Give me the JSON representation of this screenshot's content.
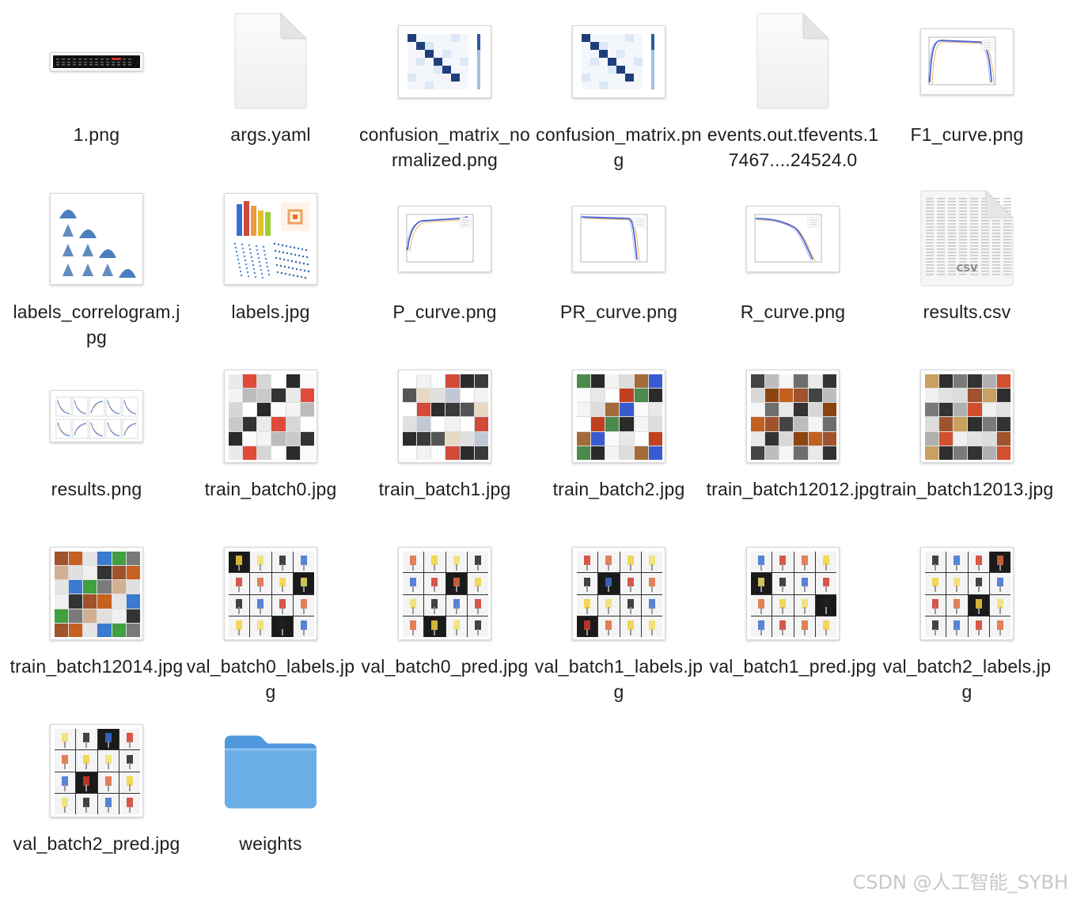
{
  "files": [
    {
      "name": "1.png",
      "icon": "image-thumbnail"
    },
    {
      "name": "args.yaml",
      "icon": "blank-document-icon"
    },
    {
      "name": "confusion_matrix_normalized.png",
      "icon": "confusion-matrix-thumbnail"
    },
    {
      "name": "confusion_matrix.png",
      "icon": "confusion-matrix-thumbnail"
    },
    {
      "name": "events.out.tfevents.17467....24524.0",
      "icon": "blank-document-icon"
    },
    {
      "name": "F1_curve.png",
      "icon": "curve-chart-thumbnail"
    },
    {
      "name": "labels_correlogram.jpg",
      "icon": "correlogram-thumbnail"
    },
    {
      "name": "labels.jpg",
      "icon": "labels-chart-thumbnail"
    },
    {
      "name": "P_curve.png",
      "icon": "curve-chart-thumbnail"
    },
    {
      "name": "PR_curve.png",
      "icon": "curve-chart-thumbnail"
    },
    {
      "name": "R_curve.png",
      "icon": "curve-chart-thumbnail"
    },
    {
      "name": "results.csv",
      "icon": "csv-document-icon"
    },
    {
      "name": "results.png",
      "icon": "results-plots-thumbnail"
    },
    {
      "name": "train_batch0.jpg",
      "icon": "photo-mosaic-thumbnail"
    },
    {
      "name": "train_batch1.jpg",
      "icon": "photo-mosaic-thumbnail"
    },
    {
      "name": "train_batch2.jpg",
      "icon": "photo-mosaic-thumbnail"
    },
    {
      "name": "train_batch12012.jpg",
      "icon": "photo-mosaic-thumbnail"
    },
    {
      "name": "train_batch12013.jpg",
      "icon": "photo-mosaic-thumbnail"
    },
    {
      "name": "train_batch12014.jpg",
      "icon": "photo-mosaic-thumbnail"
    },
    {
      "name": "val_batch0_labels.jpg",
      "icon": "val-grid-thumbnail"
    },
    {
      "name": "val_batch0_pred.jpg",
      "icon": "val-grid-thumbnail"
    },
    {
      "name": "val_batch1_labels.jpg",
      "icon": "val-grid-thumbnail"
    },
    {
      "name": "val_batch1_pred.jpg",
      "icon": "val-grid-thumbnail"
    },
    {
      "name": "val_batch2_labels.jpg",
      "icon": "val-grid-thumbnail"
    },
    {
      "name": "val_batch2_pred.jpg",
      "icon": "val-grid-thumbnail"
    },
    {
      "name": "weights",
      "icon": "folder-icon"
    }
  ],
  "csv_badge": "CSV",
  "watermark": "CSDN @人工智能_SYBH",
  "colors": {
    "folder": "#6aaee8",
    "folder_tab": "#4f98dc",
    "matrix": "#1f3f7a",
    "curve": "#3a5bd0"
  }
}
